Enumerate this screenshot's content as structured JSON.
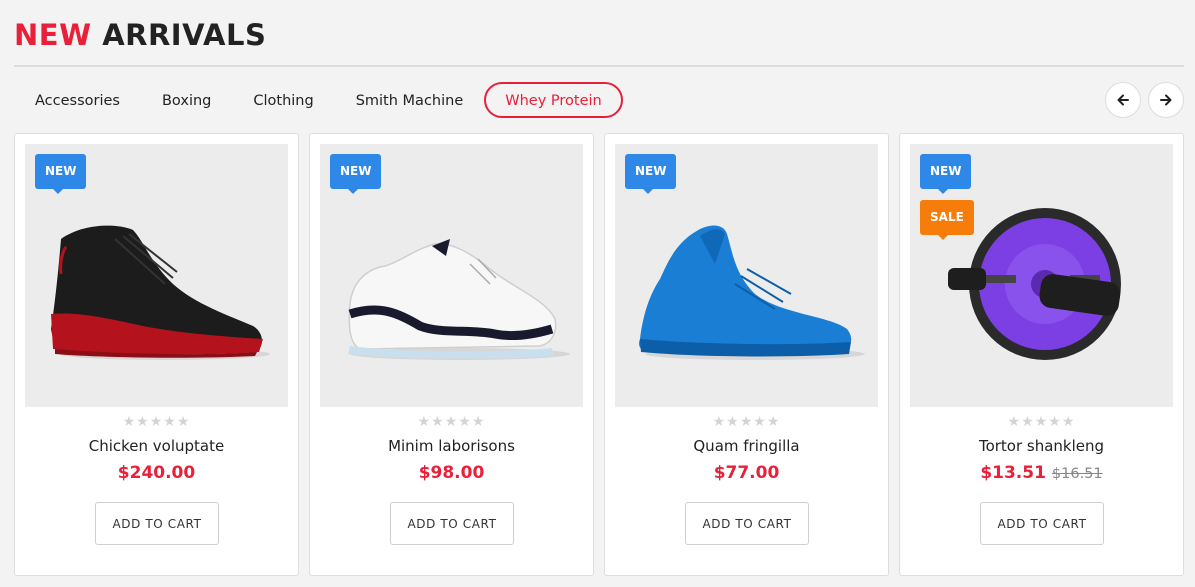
{
  "section": {
    "title_accent": "NEW",
    "title_rest": "ARRIVALS"
  },
  "tabs": [
    {
      "label": "Accessories",
      "active": false
    },
    {
      "label": "Boxing",
      "active": false
    },
    {
      "label": "Clothing",
      "active": false
    },
    {
      "label": "Smith Machine",
      "active": false
    },
    {
      "label": "Whey Protein",
      "active": true
    }
  ],
  "nav": {
    "prev_icon": "arrow-left-icon",
    "next_icon": "arrow-right-icon"
  },
  "rating_scale": 5,
  "colors": {
    "accent": "#e8203a",
    "badge_new": "#2e88e8",
    "badge_sale": "#f67d0a"
  },
  "products": [
    {
      "badges": [
        "NEW"
      ],
      "image": "black-red-basketball-sneaker",
      "rating": 0,
      "name": "Chicken voluptate",
      "price": "$240.00",
      "old_price": "",
      "cart_label": "ADD TO CART"
    },
    {
      "badges": [
        "NEW"
      ],
      "image": "white-navy-basketball-sneaker",
      "rating": 0,
      "name": "Minim laborisons",
      "price": "$98.00",
      "old_price": "",
      "cart_label": "ADD TO CART"
    },
    {
      "badges": [
        "NEW"
      ],
      "image": "blue-basketball-sneaker",
      "rating": 0,
      "name": "Quam fringilla",
      "price": "$77.00",
      "old_price": "",
      "cart_label": "ADD TO CART"
    },
    {
      "badges": [
        "NEW",
        "SALE"
      ],
      "image": "purple-ab-roller-wheel",
      "rating": 0,
      "name": "Tortor shankleng",
      "price": "$13.51",
      "old_price": "$16.51",
      "cart_label": "ADD TO CART"
    }
  ]
}
